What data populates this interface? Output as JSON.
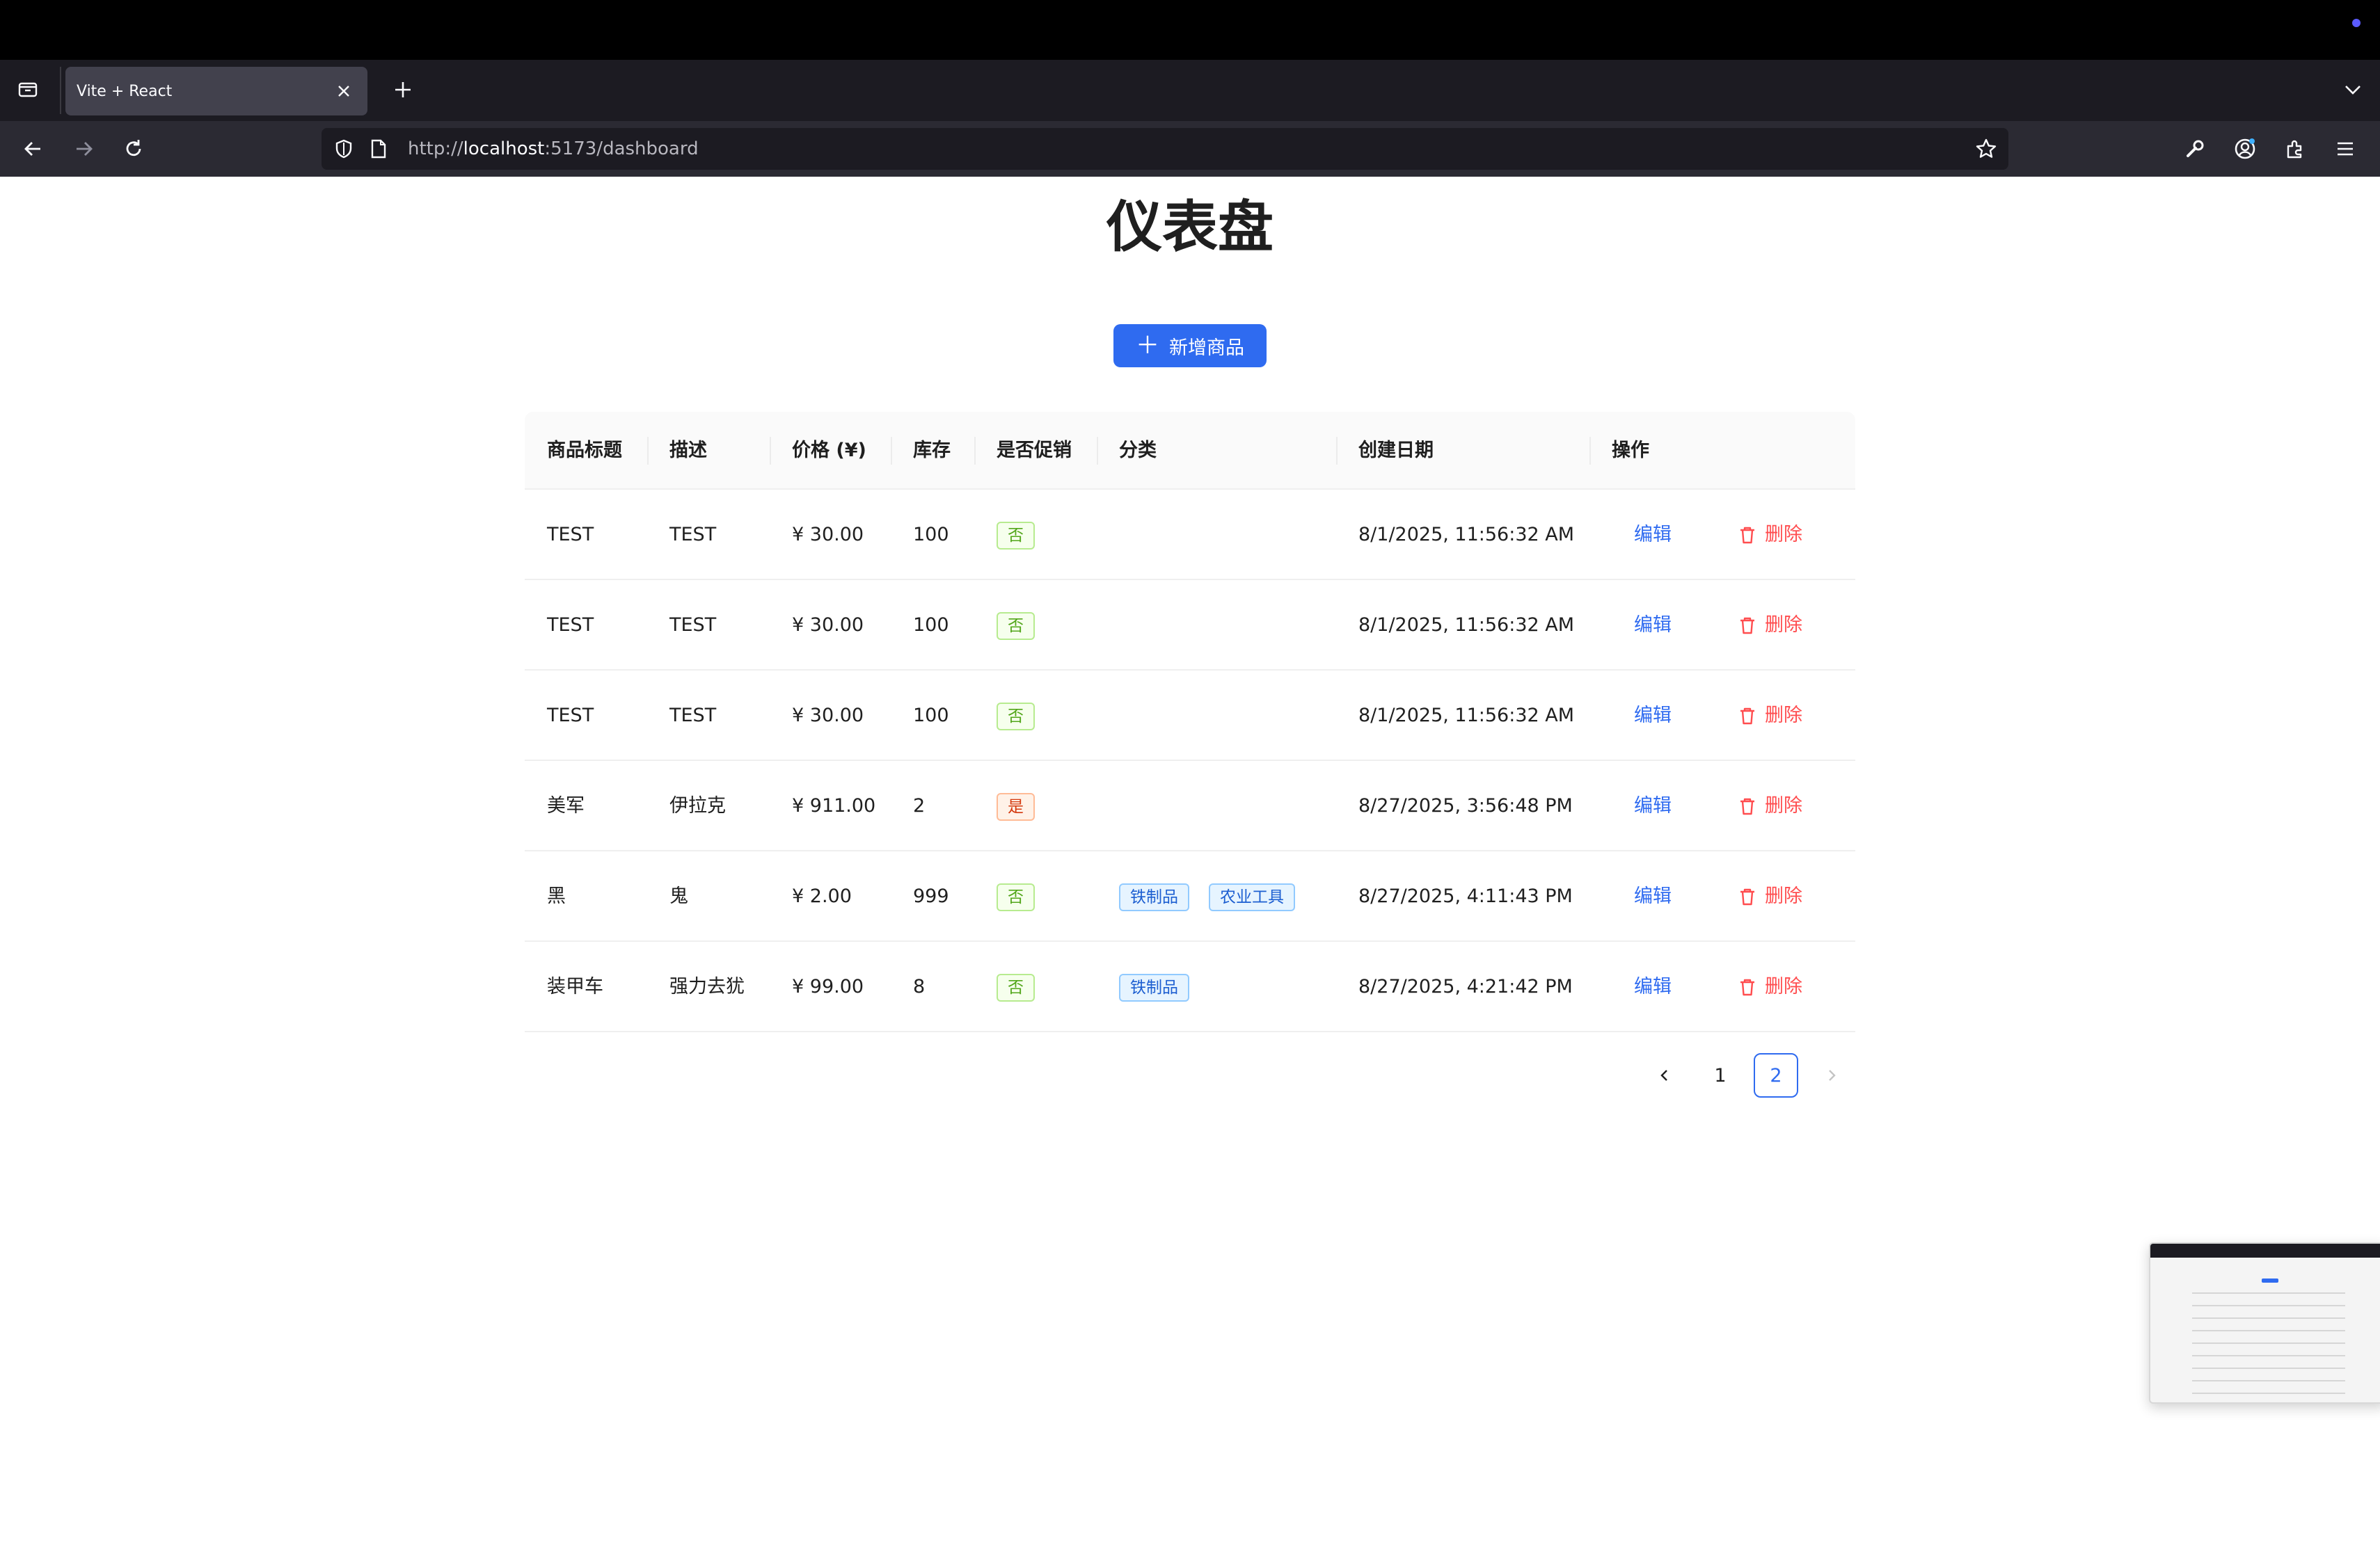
{
  "browser": {
    "tab_title": "Vite + React",
    "url_prefix": "http://",
    "url_host": "localhost",
    "url_rest": ":5173/dashboard"
  },
  "page": {
    "title": "仪表盘",
    "add_button_label": "新增商品"
  },
  "table": {
    "headers": [
      "商品标题",
      "描述",
      "价格 (¥)",
      "库存",
      "是否促销",
      "分类",
      "创建日期",
      "操作"
    ],
    "edit_label": "编辑",
    "delete_label": "删除",
    "rows": [
      {
        "title": "TEST",
        "desc": "TEST",
        "price": "¥ 30.00",
        "stock": "100",
        "promo": "否",
        "promo_state": "no",
        "categories": [],
        "created": "8/1/2025, 11:56:32 AM"
      },
      {
        "title": "TEST",
        "desc": "TEST",
        "price": "¥ 30.00",
        "stock": "100",
        "promo": "否",
        "promo_state": "no",
        "categories": [],
        "created": "8/1/2025, 11:56:32 AM"
      },
      {
        "title": "TEST",
        "desc": "TEST",
        "price": "¥ 30.00",
        "stock": "100",
        "promo": "否",
        "promo_state": "no",
        "categories": [],
        "created": "8/1/2025, 11:56:32 AM"
      },
      {
        "title": "美军",
        "desc": "伊拉克",
        "price": "¥ 911.00",
        "stock": "2",
        "promo": "是",
        "promo_state": "yes",
        "categories": [],
        "created": "8/27/2025, 3:56:48 PM"
      },
      {
        "title": "黑",
        "desc": "鬼",
        "price": "¥ 2.00",
        "stock": "999",
        "promo": "否",
        "promo_state": "no",
        "categories": [
          "铁制品",
          "农业工具"
        ],
        "created": "8/27/2025, 4:11:43 PM"
      },
      {
        "title": "装甲车",
        "desc": "强力去犹",
        "price": "¥ 99.00",
        "stock": "8",
        "promo": "否",
        "promo_state": "no",
        "categories": [
          "铁制品"
        ],
        "created": "8/27/2025, 4:21:42 PM"
      }
    ]
  },
  "pagination": {
    "pages": [
      "1",
      "2"
    ],
    "current": "2"
  },
  "colors": {
    "primary": "#2f6bf0",
    "danger": "#ff4d4f",
    "tag_green": "#52a61a",
    "tag_orange": "#d4380d"
  }
}
